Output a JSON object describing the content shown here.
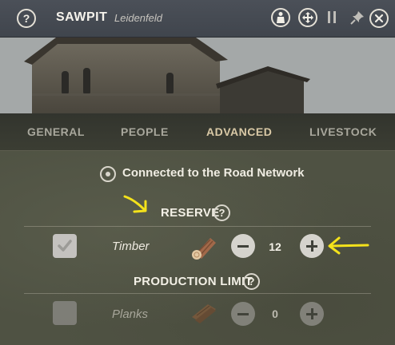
{
  "header": {
    "title": "SAWPIT",
    "subtitle": "Leidenfeld",
    "help_glyph": "?",
    "icons": [
      "question-icon",
      "worker-icon",
      "move-icon",
      "pause-icon",
      "pin-icon",
      "close-icon"
    ]
  },
  "tabs": [
    {
      "label": "GENERAL",
      "active": false
    },
    {
      "label": "PEOPLE",
      "active": false
    },
    {
      "label": "ADVANCED",
      "active": true
    },
    {
      "label": "LIVESTOCK",
      "active": false
    }
  ],
  "road": {
    "text": "Connected to the Road Network"
  },
  "reserve": {
    "title": "RESERVE",
    "help_glyph": "?",
    "item": {
      "label": "Timber",
      "checked": true,
      "quantity": "12",
      "icon": "log-icon"
    }
  },
  "production_limit": {
    "title": "PRODUCTION LIMIT",
    "help_glyph": "?",
    "item": {
      "label": "Planks",
      "checked": false,
      "quantity": "0",
      "icon": "planks-icon"
    }
  },
  "colors": {
    "accent": "#f4e21b",
    "active_tab": "#d9c9a6",
    "panel": "#4f5243"
  }
}
